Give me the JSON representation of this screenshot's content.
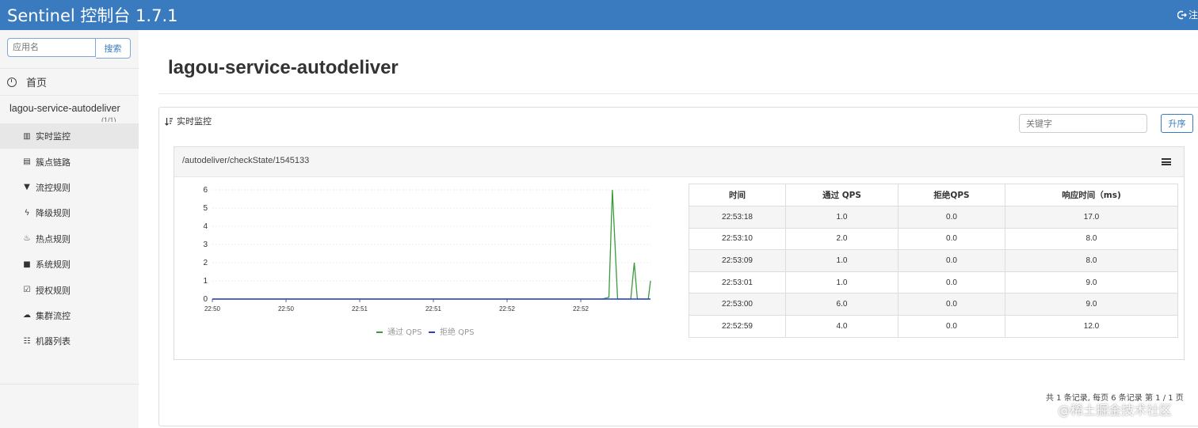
{
  "app": {
    "title": "Sentinel 控制台 1.7.1",
    "logout_label": "注"
  },
  "sidebar": {
    "search": {
      "placeholder": "应用名",
      "button": "搜索"
    },
    "home_label": "首页",
    "app_name": "lagou-service-autodeliver",
    "app_count": "(1/1)",
    "items": [
      {
        "label": "实时监控",
        "icon": "bar-chart-icon",
        "active": true
      },
      {
        "label": "簇点链路",
        "icon": "list-icon",
        "active": false
      },
      {
        "label": "流控规则",
        "icon": "filter-icon",
        "active": false
      },
      {
        "label": "降级规则",
        "icon": "bolt-icon",
        "active": false
      },
      {
        "label": "热点规则",
        "icon": "fire-icon",
        "active": false
      },
      {
        "label": "系统规则",
        "icon": "lock-icon",
        "active": false
      },
      {
        "label": "授权规则",
        "icon": "check-square-icon",
        "active": false
      },
      {
        "label": "集群流控",
        "icon": "cloud-icon",
        "active": false
      },
      {
        "label": "机器列表",
        "icon": "grid-list-icon",
        "active": false
      }
    ]
  },
  "main": {
    "title": "lagou-service-autodeliver",
    "panel_title": "实时监控",
    "keyword_placeholder": "关键字",
    "sort_button": "升序",
    "resource": "/autodeliver/checkState/1545133",
    "table": {
      "headers": [
        "时间",
        "通过 QPS",
        "拒绝QPS",
        "响应时间（ms)"
      ],
      "rows": [
        [
          "22:53:18",
          "1.0",
          "0.0",
          "17.0"
        ],
        [
          "22:53:10",
          "2.0",
          "0.0",
          "8.0"
        ],
        [
          "22:53:09",
          "1.0",
          "0.0",
          "8.0"
        ],
        [
          "22:53:01",
          "1.0",
          "0.0",
          "9.0"
        ],
        [
          "22:53:00",
          "6.0",
          "0.0",
          "9.0"
        ],
        [
          "22:52:59",
          "4.0",
          "0.0",
          "12.0"
        ]
      ]
    },
    "pager": "共 1 条记录, 每页 6 条记录 第 1 / 1 页"
  },
  "chart_data": {
    "type": "line",
    "x_ticks": [
      "22:50",
      "22:50",
      "22:51",
      "22:51",
      "22:52",
      "22:52"
    ],
    "y_ticks": [
      0,
      1,
      2,
      3,
      4,
      5,
      6
    ],
    "ylim": [
      0,
      6
    ],
    "grid": true,
    "legend_placement": "bottom-center",
    "series": [
      {
        "name": "通过 QPS",
        "color": "#3a9b3a",
        "points": [
          [
            0,
            0
          ],
          [
            0.89,
            0
          ],
          [
            0.905,
            0.1
          ],
          [
            0.913,
            6
          ],
          [
            0.925,
            0
          ],
          [
            0.955,
            0
          ],
          [
            0.963,
            2
          ],
          [
            0.97,
            0
          ],
          [
            0.995,
            0
          ],
          [
            1,
            1
          ]
        ]
      },
      {
        "name": "拒绝 QPS",
        "color": "#2a3fc4",
        "points": [
          [
            0,
            0
          ],
          [
            1,
            0
          ]
        ]
      }
    ],
    "watermark": "@稀土掘金技术社区"
  }
}
